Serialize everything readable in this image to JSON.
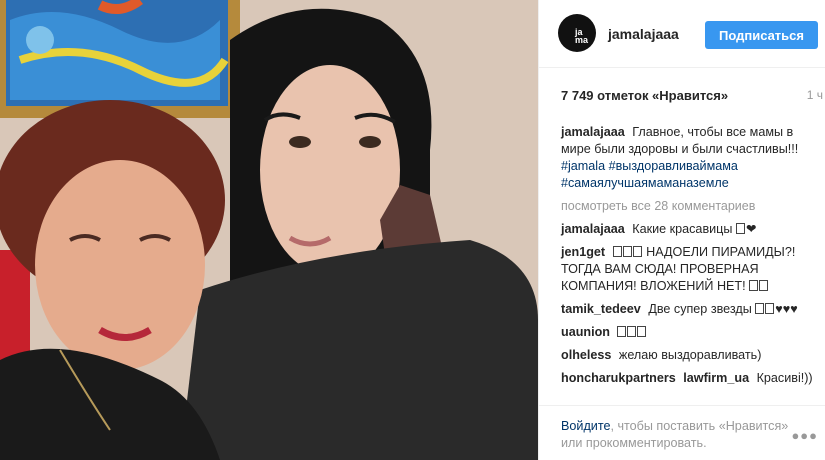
{
  "post": {
    "username": "jamalajaaa",
    "follow_label": "Подписаться",
    "likes": "7 749 отметок «Нравится»",
    "time": "1 ч",
    "avatar_letters": "ja ma",
    "caption": {
      "author": "jamalajaaa",
      "text": "Главное, чтобы все мамы в мире были здоровы и были счастливы!!!",
      "tag1": "#jamala",
      "tag2": "#выздоравливаймама",
      "tag3": "#самаялучшаямаманаземле"
    },
    "view_all": "посмотреть все 28 комментариев",
    "comments": [
      {
        "author": "jamalajaaa",
        "text": "Какие красавицы",
        "suffix": "❤"
      },
      {
        "author": "jen1get",
        "text": "НАДОЕЛИ ПИРАМИДЫ?! ТОГДА ВАМ СЮДА! ПРОВЕРНАЯ КОМПАНИЯ! ВЛОЖЕНИЙ НЕТ!"
      },
      {
        "author": "tamik_tedeev",
        "text": "Две супер звезды",
        "suffix": "♥♥♥"
      },
      {
        "author": "uaunion",
        "text": ""
      },
      {
        "author": "olheless",
        "text": "желаю выздоравливать)"
      },
      {
        "author": "honcharukpartners",
        "mention": "lawfirm_ua",
        "text": "Красиві!))"
      }
    ],
    "footer": {
      "login_link": "Войдите",
      "login_rest": ", чтобы поставить «Нравится» или прокомментировать."
    }
  },
  "colors": {
    "follow_bg": "#3897f0",
    "link": "#003569",
    "muted": "#999999"
  },
  "icons": {
    "more": "more-options-icon"
  }
}
